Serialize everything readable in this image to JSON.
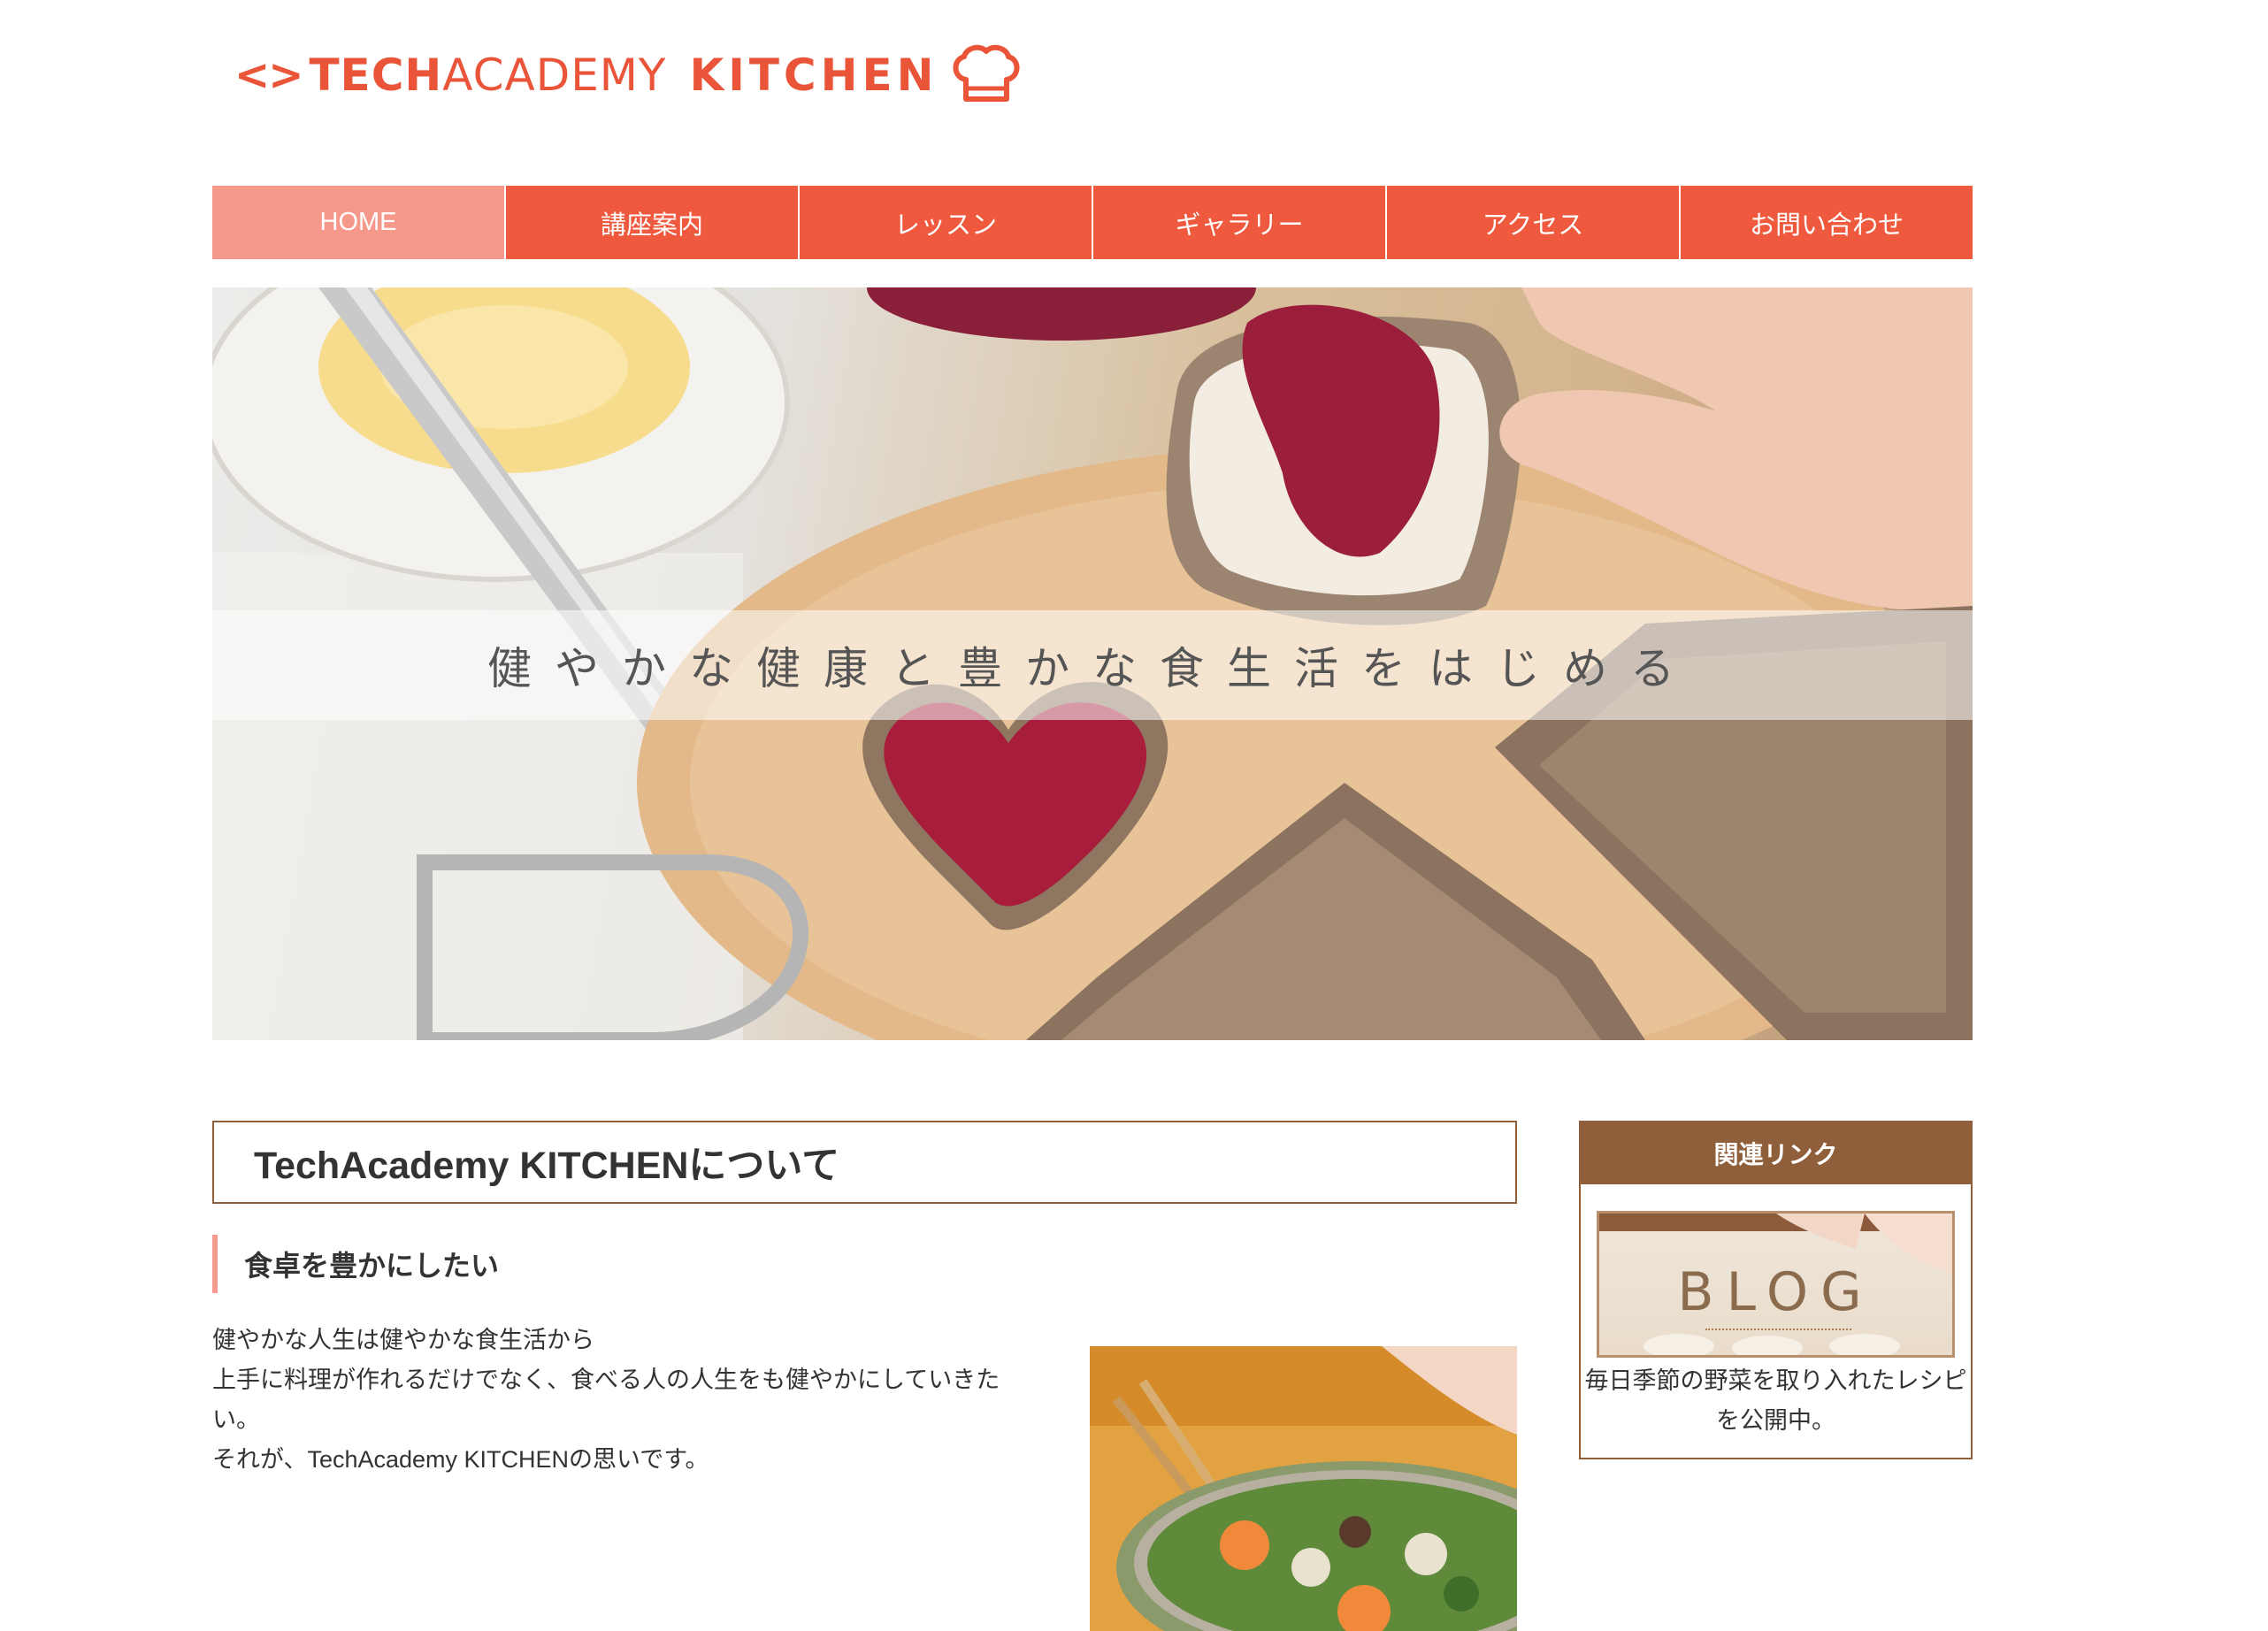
{
  "colors": {
    "accent": "#ef5a3e",
    "nav_active": "#f7998a",
    "brown": "#8f5e3a",
    "heading_bar": "#f49a8e"
  },
  "logo": {
    "code": "<>",
    "tech": "TECH",
    "academy": "ACADEMY",
    "kitchen": "KITCHEN",
    "icon": "chef-hat-icon"
  },
  "nav": {
    "items": [
      {
        "label": "HOME",
        "active": true
      },
      {
        "label": "講座案内",
        "active": false
      },
      {
        "label": "レッスン",
        "active": false
      },
      {
        "label": "ギャラリー",
        "active": false
      },
      {
        "label": "アクセス",
        "active": false
      },
      {
        "label": "お問い合わせ",
        "active": false
      }
    ]
  },
  "hero": {
    "caption": "健やかな健康と豊かな食生活をはじめる"
  },
  "main": {
    "section_title": "TechAcademy KITCHENについて",
    "sub_heading": "食卓を豊かにしたい",
    "paragraph_lines": [
      "健やかな人生は健やかな食生活から",
      "上手に料理が作れるだけでなく、食べる人の人生をも健やかにしていきたい。",
      "それが、TechAcademy KITCHENの思いです。"
    ]
  },
  "sidebar": {
    "title": "関連リンク",
    "banner_label": "BLOG",
    "description": "毎日季節の野菜を取り入れたレシピを公開中。"
  }
}
